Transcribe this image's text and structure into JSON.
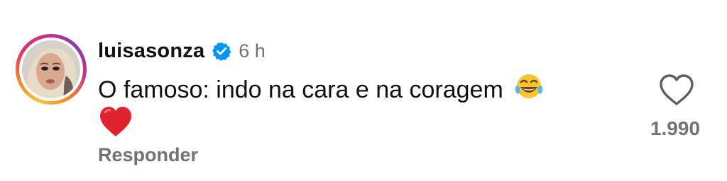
{
  "comment": {
    "username": "luisasonza",
    "verified": true,
    "time": "6 h",
    "text": "O famoso:  indo na cara e na coragem",
    "emojis": [
      "face-with-tears-of-joy",
      "red-heart"
    ],
    "reply_label": "Responder",
    "like_count": "1.990",
    "icons": {
      "avatar": "profile-photo",
      "verified": "verified-badge-icon",
      "like": "heart-outline-icon"
    },
    "colors": {
      "verified_badge": "#0095f6",
      "secondary_text": "#737373",
      "story_ring_start": "#f9c33b",
      "story_ring_end": "#c13584"
    }
  }
}
